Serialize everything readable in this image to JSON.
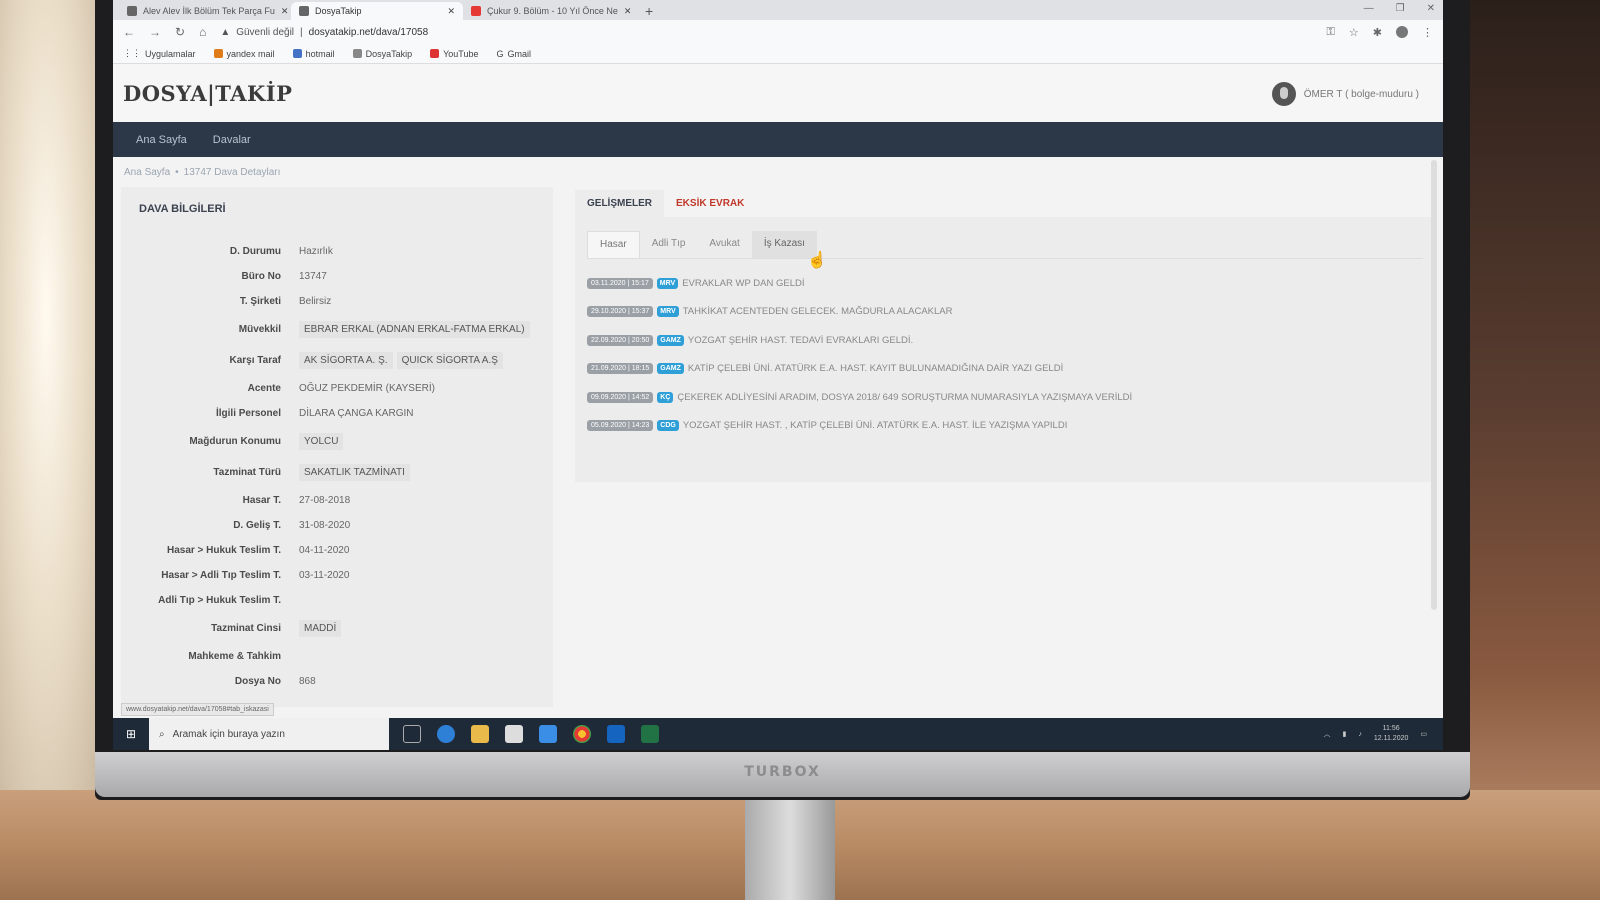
{
  "browser": {
    "tabs": [
      {
        "title": "Alev Alev İlk Bölüm Tek Parça Fu",
        "active": false
      },
      {
        "title": "DosyaTakip",
        "active": true
      },
      {
        "title": "Çukur 9. Bölüm - 10 Yıl Önce Ne",
        "active": false
      }
    ],
    "new_tab": "+",
    "security_label": "Güvenli değil",
    "url": "dosyatakip.net/dava/17058",
    "bookmarks": [
      "Uygulamalar",
      "yandex mail",
      "hotmail",
      "DosyaTakip",
      "YouTube",
      "Gmail"
    ],
    "status_url": "www.dosyatakip.net/dava/17058#tab_iskazasi"
  },
  "app": {
    "logo": "DOSYA|TAKİP",
    "user": "ÖMER T ( bolge-muduru )",
    "nav": [
      "Ana Sayfa",
      "Davalar"
    ],
    "breadcrumb": {
      "home": "Ana Sayfa",
      "separator": "•",
      "current": "13747 Dava Detayları"
    }
  },
  "case": {
    "title": "DAVA BİLGİLERİ",
    "fields": [
      {
        "label": "D. Durumu",
        "value": "Hazırlık"
      },
      {
        "label": "Büro No",
        "value": "13747"
      },
      {
        "label": "T. Şirketi",
        "value": "Belirsiz"
      },
      {
        "label": "Müvekkil",
        "tags": [
          "EBRAR ERKAL (ADNAN ERKAL-FATMA ERKAL)"
        ]
      },
      {
        "label": "Karşı Taraf",
        "tags": [
          "AK SİGORTA A. Ş.",
          "QUICK SİGORTA A.Ş"
        ]
      },
      {
        "label": "Acente",
        "value": "OĞUZ PEKDEMİR (KAYSERİ)"
      },
      {
        "label": "İlgili Personel",
        "value": "DİLARA ÇANGA KARGIN"
      },
      {
        "label": "Mağdurun Konumu",
        "tags": [
          "YOLCU"
        ]
      },
      {
        "label": "Tazminat Türü",
        "tags": [
          "SAKATLIK TAZMİNATI"
        ]
      },
      {
        "label": "Hasar T.",
        "value": "27-08-2018"
      },
      {
        "label": "D. Geliş T.",
        "value": "31-08-2020"
      },
      {
        "label": "Hasar > Hukuk Teslim T.",
        "value": "04-11-2020"
      },
      {
        "label": "Hasar > Adli Tıp Teslim T.",
        "value": "03-11-2020"
      },
      {
        "label": "Adli Tıp > Hukuk Teslim T.",
        "value": ""
      },
      {
        "label": "Tazminat Cinsi",
        "tags": [
          "MADDİ"
        ]
      },
      {
        "label": "Mahkeme & Tahkim",
        "value": ""
      },
      {
        "label": "Dosya No",
        "value": "868"
      }
    ]
  },
  "developments": {
    "tabs": [
      "GELİŞMELER",
      "EKSİK EVRAK"
    ],
    "subtabs": [
      "Hasar",
      "Adli Tıp",
      "Avukat",
      "İş Kazası"
    ],
    "events": [
      {
        "date": "03.11.2020 | 15:17",
        "tag": "MRV",
        "text": "EVRAKLAR WP DAN GELDİ"
      },
      {
        "date": "29.10.2020 | 15:37",
        "tag": "MRV",
        "text": "TAHKİKAT ACENTEDEN GELECEK. MAĞDURLA ALACAKLAR"
      },
      {
        "date": "22.09.2020 | 20:50",
        "tag": "GAMZ",
        "text": "YOZGAT ŞEHİR HAST. TEDAVİ EVRAKLARI GELDİ."
      },
      {
        "date": "21.09.2020 | 18:15",
        "tag": "GAMZ",
        "text": "KATİP ÇELEBİ ÜNİ. ATATÜRK E.A. HAST. KAYIT BULUNAMADIĞINA DAİR YAZI GELDİ"
      },
      {
        "date": "09.09.2020 | 14:52",
        "tag": "KÇ",
        "text": "ÇEKEREK ADLİYESİNİ ARADIM, DOSYA 2018/ 649 SORUŞTURMA NUMARASIYLA YAZIŞMAYA VERİLDİ"
      },
      {
        "date": "05.09.2020 | 14:23",
        "tag": "CDG",
        "text": "YOZGAT ŞEHİR HAST. , KATİP ÇELEBİ ÜNİ. ATATÜRK E.A. HAST. İLE YAZIŞMA YAPILDI"
      }
    ]
  },
  "taskbar": {
    "search_placeholder": "Aramak için buraya yazın",
    "time": "11:56",
    "date": "12.11.2020"
  },
  "monitor_brand": "TURBOX",
  "colors": {
    "nav_bg": "#2c3848",
    "tag_blue": "#2f9fd8",
    "tab_red": "#c0392b"
  }
}
